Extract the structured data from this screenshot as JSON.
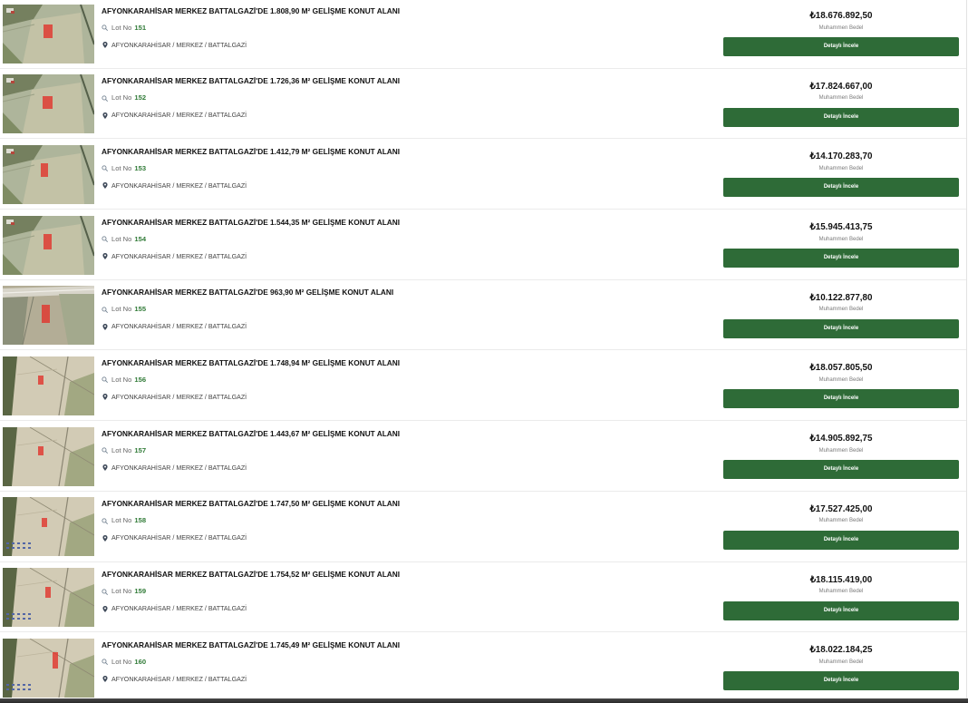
{
  "labels": {
    "lot": "Lot No",
    "price_caption": "Muhammen Bedel",
    "details_button": "Detaylı İncele"
  },
  "icons": {
    "lot": "search-icon",
    "location": "map-pin-icon"
  },
  "colors": {
    "accent": "#2e6b37",
    "lot_number": "#2f7a36"
  },
  "listings": [
    {
      "title": "AFYONKARAHİSAR MERKEZ BATTALGAZİ'DE 1.808,90 M² GELİŞME KONUT ALANI",
      "lot_no": "151",
      "location": "AFYONKARAHİSAR / MERKEZ / BATTALGAZİ",
      "price": "₺18.676.892,50"
    },
    {
      "title": "AFYONKARAHİSAR MERKEZ BATTALGAZİ'DE 1.726,36 M² GELİŞME KONUT ALANI",
      "lot_no": "152",
      "location": "AFYONKARAHİSAR / MERKEZ / BATTALGAZİ",
      "price": "₺17.824.667,00"
    },
    {
      "title": "AFYONKARAHİSAR MERKEZ BATTALGAZİ'DE 1.412,79 M² GELİŞME KONUT ALANI",
      "lot_no": "153",
      "location": "AFYONKARAHİSAR / MERKEZ / BATTALGAZİ",
      "price": "₺14.170.283,70"
    },
    {
      "title": "AFYONKARAHİSAR MERKEZ BATTALGAZİ'DE 1.544,35 M² GELİŞME KONUT ALANI",
      "lot_no": "154",
      "location": "AFYONKARAHİSAR / MERKEZ / BATTALGAZİ",
      "price": "₺15.945.413,75"
    },
    {
      "title": "AFYONKARAHİSAR MERKEZ BATTALGAZİ'DE 963,90 M² GELİŞME KONUT ALANI",
      "lot_no": "155",
      "location": "AFYONKARAHİSAR / MERKEZ / BATTALGAZİ",
      "price": "₺10.122.877,80"
    },
    {
      "title": "AFYONKARAHİSAR MERKEZ BATTALGAZİ'DE 1.748,94 M² GELİŞME KONUT ALANI",
      "lot_no": "156",
      "location": "AFYONKARAHİSAR / MERKEZ / BATTALGAZİ",
      "price": "₺18.057.805,50"
    },
    {
      "title": "AFYONKARAHİSAR MERKEZ BATTALGAZİ'DE 1.443,67 M² GELİŞME KONUT ALANI",
      "lot_no": "157",
      "location": "AFYONKARAHİSAR / MERKEZ / BATTALGAZİ",
      "price": "₺14.905.892,75"
    },
    {
      "title": "AFYONKARAHİSAR MERKEZ BATTALGAZİ'DE 1.747,50 M² GELİŞME KONUT ALANI",
      "lot_no": "158",
      "location": "AFYONKARAHİSAR / MERKEZ / BATTALGAZİ",
      "price": "₺17.527.425,00"
    },
    {
      "title": "AFYONKARAHİSAR MERKEZ BATTALGAZİ'DE 1.754,52 M² GELİŞME KONUT ALANI",
      "lot_no": "159",
      "location": "AFYONKARAHİSAR / MERKEZ / BATTALGAZİ",
      "price": "₺18.115.419,00"
    },
    {
      "title": "AFYONKARAHİSAR MERKEZ BATTALGAZİ'DE 1.745,49 M² GELİŞME KONUT ALANI",
      "lot_no": "160",
      "location": "AFYONKARAHİSAR / MERKEZ / BATTALGAZİ",
      "price": "₺18.022.184,25"
    }
  ]
}
